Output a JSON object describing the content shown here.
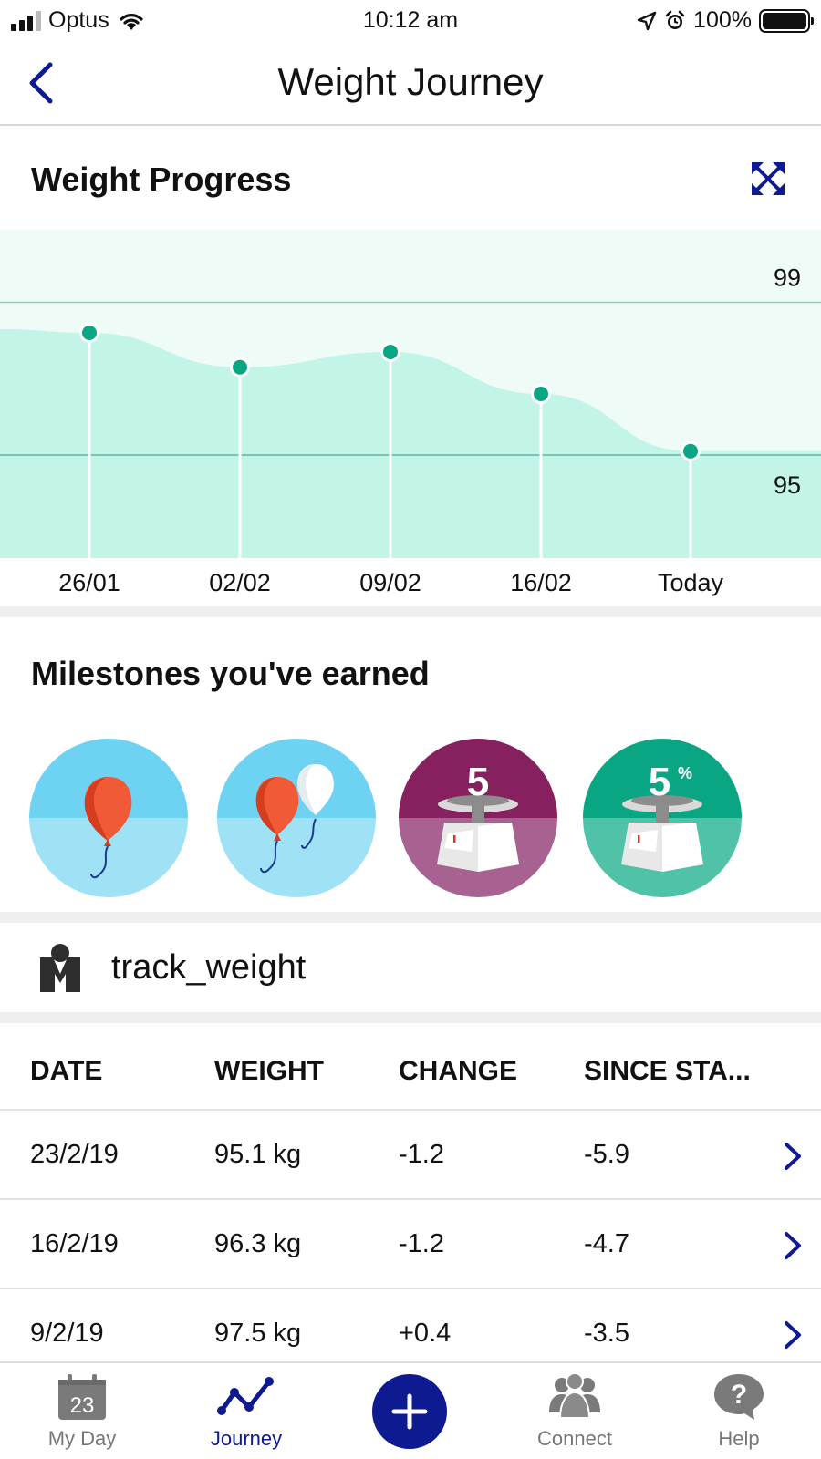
{
  "status_bar": {
    "carrier": "Optus",
    "time": "10:12 am",
    "battery": "100%"
  },
  "header": {
    "title": "Weight Journey",
    "back_icon": "chevron-left-icon"
  },
  "weight_progress": {
    "title": "Weight Progress",
    "expand_icon": "expand-arrows-icon"
  },
  "chart_data": {
    "type": "area",
    "x": [
      "26/01",
      "02/02",
      "09/02",
      "16/02",
      "Today"
    ],
    "values": [
      98.2,
      97.3,
      97.7,
      96.6,
      95.1
    ],
    "ylim": [
      92.3,
      100.9
    ],
    "reference_lines": [
      99,
      95
    ],
    "reference_labels": [
      "99",
      "95"
    ],
    "colors": {
      "fill": "#c2f4e7",
      "background": "#eefbf7",
      "point": "#0aa583",
      "line": "#7fd6bf"
    }
  },
  "milestones": {
    "title": "Milestones you've earned",
    "badges": [
      {
        "icon": "single-balloon-icon"
      },
      {
        "icon": "two-balloons-icon"
      },
      {
        "icon": "scale-5-icon",
        "number": "5"
      },
      {
        "icon": "scale-5-percent-icon",
        "number": "5",
        "suffix": "%"
      }
    ]
  },
  "track": {
    "label": "track_weight",
    "icon": "scale-person-icon"
  },
  "table": {
    "headers": [
      "DATE",
      "WEIGHT",
      "CHANGE",
      "SINCE STA..."
    ],
    "rows": [
      {
        "date": "23/2/19",
        "weight": "95.1 kg",
        "change": "-1.2",
        "since_start": "-5.9"
      },
      {
        "date": "16/2/19",
        "weight": "96.3 kg",
        "change": "-1.2",
        "since_start": "-4.7"
      },
      {
        "date": "9/2/19",
        "weight": "97.5 kg",
        "change": "+0.4",
        "since_start": "-3.5"
      }
    ]
  },
  "tab_bar": {
    "tabs": [
      {
        "label": "My Day",
        "icon": "calendar-icon",
        "badge": "23",
        "active": false
      },
      {
        "label": "Journey",
        "icon": "journey-line-icon",
        "active": true
      },
      {
        "label": "",
        "icon": "plus-icon",
        "active": false
      },
      {
        "label": "Connect",
        "icon": "people-icon",
        "active": false
      },
      {
        "label": "Help",
        "icon": "help-bubble-icon",
        "active": false
      }
    ]
  },
  "colors": {
    "accent": "#0e1a8f",
    "teal": "#0aa583",
    "purple": "#86205f",
    "sky": "#6ed3f2"
  }
}
